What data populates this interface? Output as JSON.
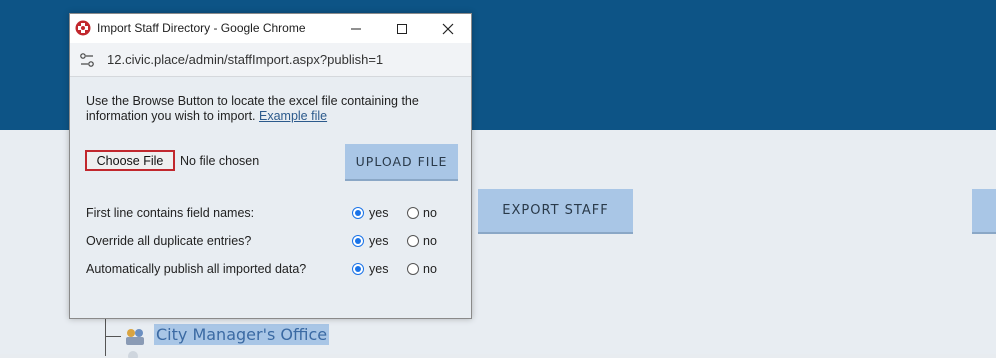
{
  "page": {
    "export_label": "EXPORT STAFF",
    "tree_item_label": "City Manager's Office"
  },
  "window": {
    "title": "Import Staff Directory - Google Chrome",
    "url": "12.civic.place/admin/staffImport.aspx?publish=1",
    "controls": {
      "minimize": "minimize-icon",
      "maximize": "maximize-icon",
      "close": "close-icon"
    }
  },
  "dialog": {
    "intro_text": "Use the Browse Button to locate the excel file containing the information you wish to import.",
    "example_link": "Example file",
    "choose_file_label": "Choose File",
    "no_file_text": "No file chosen",
    "upload_label": "UPLOAD FILE",
    "options": [
      {
        "label": "First line contains field names:",
        "yes": "yes",
        "no": "no",
        "selected": "yes"
      },
      {
        "label": "Override all duplicate entries?",
        "yes": "yes",
        "no": "no",
        "selected": "yes"
      },
      {
        "label": "Automatically publish all imported data?",
        "yes": "yes",
        "no": "no",
        "selected": "yes"
      }
    ]
  },
  "colors": {
    "header_blue": "#0d5486",
    "button_blue": "#a9c6e6",
    "radio_accent": "#1a73e8",
    "highlight_red": "#c1272d"
  }
}
